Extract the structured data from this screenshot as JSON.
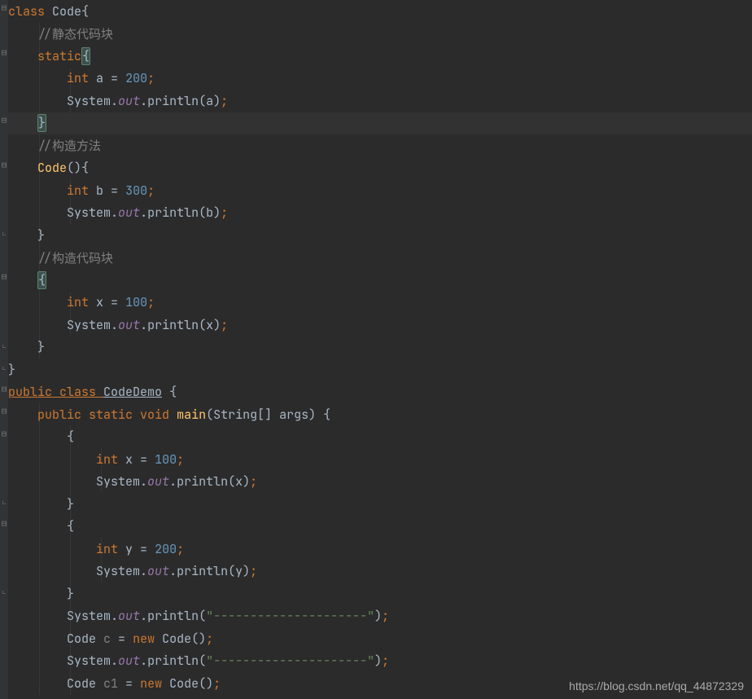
{
  "watermark": "https://blog.csdn.net/qq_44872329",
  "code": {
    "l0": {
      "class": "class ",
      "Code": "Code",
      "ob": "{"
    },
    "l1": {
      "cmt": "//静态代码块"
    },
    "l2": {
      "static": "static",
      "ob": "{"
    },
    "l3": {
      "int": "int ",
      "a": "a ",
      "eq": "= ",
      "n200": "200",
      "semi": ";"
    },
    "l4": {
      "System": "System",
      "dot1": ".",
      "out": "out",
      "dot2": ".",
      "println": "println",
      "op": "(",
      "a": "a",
      "cp": ")",
      "semi": ";"
    },
    "l5": {
      "cb": "}"
    },
    "l6": {
      "cmt": "//构造方法"
    },
    "l7": {
      "Code": "Code",
      "p": "()",
      "ob": "{"
    },
    "l8": {
      "int": "int ",
      "b": "b ",
      "eq": "= ",
      "n300": "300",
      "semi": ";"
    },
    "l9": {
      "System": "System",
      "dot1": ".",
      "out": "out",
      "dot2": ".",
      "println": "println",
      "op": "(",
      "b": "b",
      "cp": ")",
      "semi": ";"
    },
    "l10": {
      "cb": "}"
    },
    "l11": {
      "cmt": "//构造代码块"
    },
    "l12": {
      "ob": "{"
    },
    "l13": {
      "int": "int ",
      "x": "x ",
      "eq": "= ",
      "n100": "100",
      "semi": ";"
    },
    "l14": {
      "System": "System",
      "dot1": ".",
      "out": "out",
      "dot2": ".",
      "println": "println",
      "op": "(",
      "x": "x",
      "cp": ")",
      "semi": ";"
    },
    "l15": {
      "cb": "}"
    },
    "l16": {
      "cb": "}"
    },
    "l17": {
      "public": "public ",
      "class": "class ",
      "CodeDemo": "CodeDemo",
      "sp": " ",
      "ob": "{"
    },
    "l18": {
      "public": "public ",
      "static": "static ",
      "void": "void ",
      "main": "main",
      "op": "(",
      "String": "String",
      "br": "[] ",
      "args": "args",
      "cp": ") ",
      "ob": "{"
    },
    "l19": {
      "ob": "{"
    },
    "l20": {
      "int": "int ",
      "x": "x ",
      "eq": "= ",
      "n100": "100",
      "semi": ";"
    },
    "l21": {
      "System": "System",
      "dot1": ".",
      "out": "out",
      "dot2": ".",
      "println": "println",
      "op": "(",
      "x": "x",
      "cp": ")",
      "semi": ";"
    },
    "l22": {
      "cb": "}"
    },
    "l23": {
      "ob": "{"
    },
    "l24": {
      "int": "int ",
      "y": "y ",
      "eq": "= ",
      "n200": "200",
      "semi": ";"
    },
    "l25": {
      "System": "System",
      "dot1": ".",
      "out": "out",
      "dot2": ".",
      "println": "println",
      "op": "(",
      "y": "y",
      "cp": ")",
      "semi": ";"
    },
    "l26": {
      "cb": "}"
    },
    "l27": {
      "System": "System",
      "dot1": ".",
      "out": "out",
      "dot2": ".",
      "println": "println",
      "op": "(",
      "s": "\"---------------------\"",
      "cp": ")",
      "semi": ";"
    },
    "l28": {
      "Code": "Code ",
      "c": "c ",
      "eq": "= ",
      "new": "new ",
      "Code2": "Code",
      "p": "()",
      "semi": ";"
    },
    "l29": {
      "System": "System",
      "dot1": ".",
      "out": "out",
      "dot2": ".",
      "println": "println",
      "op": "(",
      "s": "\"---------------------\"",
      "cp": ")",
      "semi": ";"
    },
    "l30": {
      "Code": "Code ",
      "c1": "c1 ",
      "eq": "= ",
      "new": "new ",
      "Code2": "Code",
      "p": "()",
      "semi": ";"
    }
  }
}
